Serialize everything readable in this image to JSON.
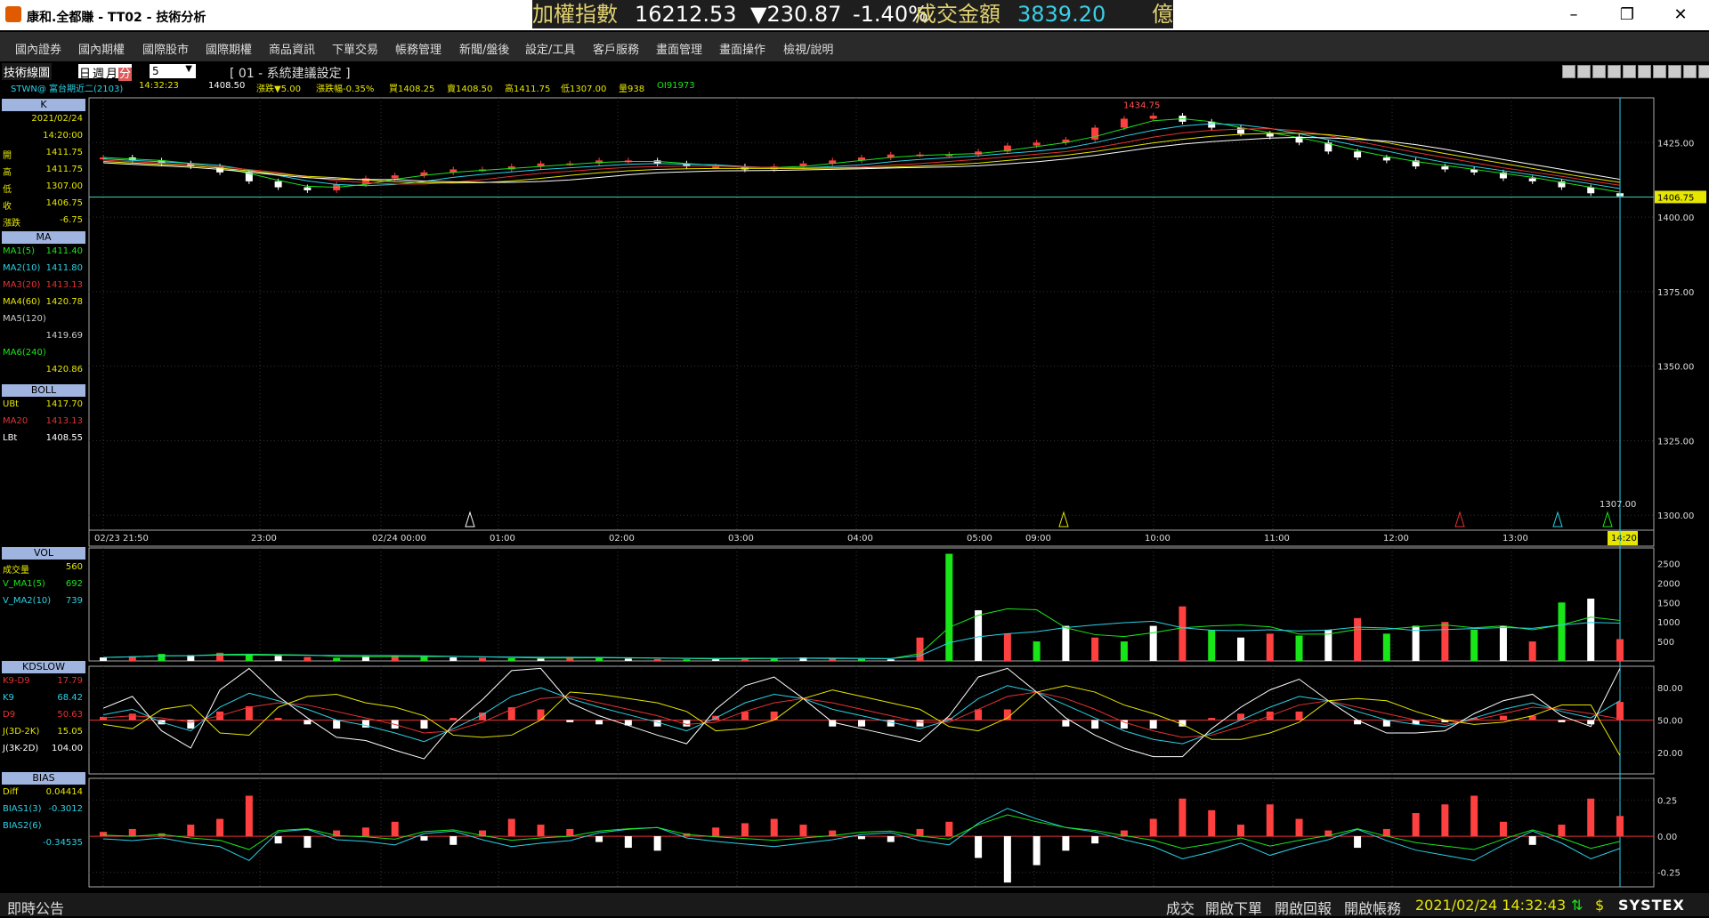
{
  "app": {
    "title": "康和.全都賺 - TT02 - 技術分析"
  },
  "ticker": {
    "name": "加權指數",
    "value": "16212.53",
    "change": "▼230.87",
    "pct": "-1.40%",
    "turnover_label": "成交金額",
    "turnover": "3839.20",
    "unit": "億"
  },
  "menu": [
    "國內證券",
    "國內期權",
    "國際股市",
    "國際期權",
    "商品資訊",
    "下單交易",
    "帳務管理",
    "新聞/盤後",
    "設定/工具",
    "客戶服務",
    "畫面管理",
    "畫面操作",
    "檢視/說明"
  ],
  "toolbar": {
    "panel_label": "技術線圖",
    "periods": [
      "日",
      "週",
      "月",
      "分"
    ],
    "interval": "5",
    "setting": "[ 01 - 系統建議設定 ]",
    "symbol": "STWN@ 富台期近二(2103)",
    "time": "14:32:23",
    "price": "1408.50",
    "change": "漲跌▼5.00",
    "change_pct": "漲跌幅-0.35%",
    "bid": "買1408.25",
    "ask": "賣1408.50",
    "high": "高1411.75",
    "low": "低1307.00",
    "volume": "量938",
    "oi": "OI91973"
  },
  "sidebar": {
    "k_head": "K",
    "k": [
      {
        "l": "",
        "r": "2021/02/24"
      },
      {
        "l": "",
        "r": "14:20:00"
      },
      {
        "l": "開",
        "r": "1411.75"
      },
      {
        "l": "高",
        "r": "1411.75"
      },
      {
        "l": "低",
        "r": "1307.00"
      },
      {
        "l": "收",
        "r": "1406.75"
      },
      {
        "l": "漲跌",
        "r": "-6.75"
      }
    ],
    "ma_head": "MA",
    "ma": [
      {
        "l": "MA1(5)",
        "r": "1411.40",
        "c": "#19e619"
      },
      {
        "l": "MA2(10)",
        "r": "1411.80",
        "c": "#29d2e6"
      },
      {
        "l": "MA3(20)",
        "r": "1413.13",
        "c": "#e63232"
      },
      {
        "l": "MA4(60)",
        "r": "1420.78",
        "c": "#e6e600"
      },
      {
        "l": "MA5(120)",
        "r": "",
        "c": "#cccccc"
      },
      {
        "l": "",
        "r": "1419.69",
        "c": "#cccccc"
      },
      {
        "l": "MA6(240)",
        "r": "",
        "c": "#19e619"
      },
      {
        "l": "",
        "r": "1420.86",
        "c": "#e6e600"
      }
    ],
    "boll_head": "BOLL",
    "boll": [
      {
        "l": "UBt",
        "r": "1417.70",
        "c": "#e6e600"
      },
      {
        "l": "MA20",
        "r": "1413.13",
        "c": "#e63232"
      },
      {
        "l": "LBt",
        "r": "1408.55",
        "c": "#ffffff"
      }
    ],
    "vol_head": "VOL",
    "vol": [
      {
        "l": "成交量",
        "r": "560",
        "c": "#e6e600"
      },
      {
        "l": "V_MA1(5)",
        "r": "692",
        "c": "#19e619"
      },
      {
        "l": "V_MA2(10)",
        "r": "739",
        "c": "#29d2e6"
      }
    ],
    "kd_head": "KDSLOW",
    "kd": [
      {
        "l": "K9-D9",
        "r": "17.79",
        "c": "#e63232"
      },
      {
        "l": "K9",
        "r": "68.42",
        "c": "#29d2e6"
      },
      {
        "l": "D9",
        "r": "50.63",
        "c": "#e63232"
      },
      {
        "l": "J(3D-2K)",
        "r": "15.05",
        "c": "#e6e600"
      },
      {
        "l": "J(3K-2D)",
        "r": "104.00",
        "c": "#ffffff"
      }
    ],
    "bias_head": "BIAS",
    "bias": [
      {
        "l": "Diff",
        "r": "0.04414",
        "c": "#e6e600"
      },
      {
        "l": "BIAS1(3)",
        "r": "-0.3012",
        "c": "#29d2e6"
      },
      {
        "l": "BIAS2(6)",
        "r": "",
        "c": "#29d2e6"
      },
      {
        "l": "",
        "r": "-0.34535",
        "c": "#29d2e6"
      }
    ]
  },
  "chart_data": [
    {
      "type": "line",
      "panel": "K",
      "title": "",
      "y_ticks": [
        "1425.00",
        "1400.00",
        "1375.00",
        "1350.00",
        "1325.00",
        "1300.00"
      ],
      "ylim": [
        1295,
        1440
      ],
      "x_labels": [
        "02/23 21:50",
        "23:00",
        "02/24 00:00",
        "01:00",
        "02:00",
        "03:00",
        "04:00",
        "05:00",
        "09:00",
        "10:00",
        "11:00",
        "12:00",
        "13:00",
        "14:20"
      ],
      "annotations": {
        "high": "1434.75",
        "low": "1307.00",
        "last": "1406.75"
      },
      "close": [
        1420,
        1419,
        1418,
        1417,
        1415,
        1412,
        1410,
        1409,
        1411,
        1413,
        1414,
        1415,
        1416,
        1416,
        1417,
        1418,
        1418,
        1419,
        1419,
        1418,
        1417,
        1417,
        1416,
        1417,
        1418,
        1419,
        1420,
        1421,
        1421,
        1421,
        1422,
        1424,
        1425,
        1426,
        1430,
        1433,
        1434,
        1432,
        1430,
        1428,
        1427,
        1425,
        1422,
        1420,
        1419,
        1417,
        1416,
        1415,
        1413,
        1412,
        1410,
        1408,
        1407
      ]
    },
    {
      "type": "bar",
      "panel": "VOL",
      "y_ticks": [
        "2500",
        "2000",
        "1500",
        "1000",
        "500"
      ],
      "ylim": [
        0,
        2900
      ],
      "values": [
        90,
        120,
        180,
        150,
        210,
        160,
        130,
        100,
        80,
        120,
        140,
        110,
        90,
        80,
        70,
        60,
        90,
        100,
        60,
        50,
        40,
        60,
        80,
        70,
        90,
        60,
        50,
        40,
        600,
        2750,
        1300,
        700,
        500,
        900,
        600,
        500,
        900,
        1400,
        800,
        600,
        700,
        650,
        800,
        1100,
        700,
        900,
        1000,
        800,
        900,
        500,
        1500,
        1600,
        560
      ]
    },
    {
      "type": "line",
      "panel": "KDSLOW",
      "y_ticks": [
        "80.00",
        "50.00",
        "20.00"
      ],
      "ylim": [
        0,
        100
      ],
      "k": [
        55,
        60,
        48,
        40,
        62,
        75,
        68,
        60,
        50,
        45,
        38,
        30,
        42,
        55,
        72,
        80,
        70,
        62,
        55,
        48,
        40,
        52,
        66,
        74,
        70,
        60,
        54,
        48,
        42,
        50,
        70,
        82,
        76,
        64,
        52,
        40,
        32,
        28,
        38,
        50,
        62,
        72,
        68,
        58,
        50,
        46,
        44,
        52,
        60,
        66,
        58,
        52,
        68
      ],
      "d": [
        52,
        54,
        52,
        48,
        54,
        62,
        66,
        64,
        58,
        52,
        46,
        38,
        40,
        48,
        60,
        70,
        72,
        66,
        60,
        54,
        46,
        48,
        58,
        66,
        70,
        66,
        60,
        54,
        48,
        48,
        60,
        72,
        76,
        70,
        60,
        48,
        40,
        34,
        36,
        44,
        54,
        64,
        68,
        62,
        56,
        50,
        46,
        50,
        56,
        62,
        60,
        56,
        51
      ]
    },
    {
      "type": "bar",
      "panel": "BIAS",
      "y_ticks": [
        "0.25",
        "0.00",
        "-0.25"
      ],
      "ylim": [
        -0.35,
        0.4
      ],
      "values": [
        0.03,
        0.05,
        0.02,
        0.08,
        0.12,
        0.28,
        -0.05,
        -0.08,
        0.04,
        0.06,
        0.1,
        -0.03,
        -0.06,
        0.04,
        0.12,
        0.08,
        0.05,
        -0.04,
        -0.08,
        -0.1,
        0.02,
        0.06,
        0.09,
        0.12,
        0.08,
        0.04,
        -0.02,
        -0.04,
        0.05,
        0.1,
        -0.15,
        -0.32,
        -0.2,
        -0.1,
        -0.05,
        0.04,
        0.12,
        0.26,
        0.18,
        0.08,
        0.22,
        0.12,
        0.04,
        -0.08,
        0.05,
        0.16,
        0.22,
        0.28,
        0.1,
        -0.06,
        0.08,
        0.26,
        0.14
      ]
    }
  ],
  "status": {
    "notice": "即時公告",
    "items": [
      "成交",
      "開啟下單",
      "開啟回報",
      "開啟帳務"
    ],
    "datetime": "2021/02/24 14:32:43",
    "brand": "SYSTEX"
  }
}
